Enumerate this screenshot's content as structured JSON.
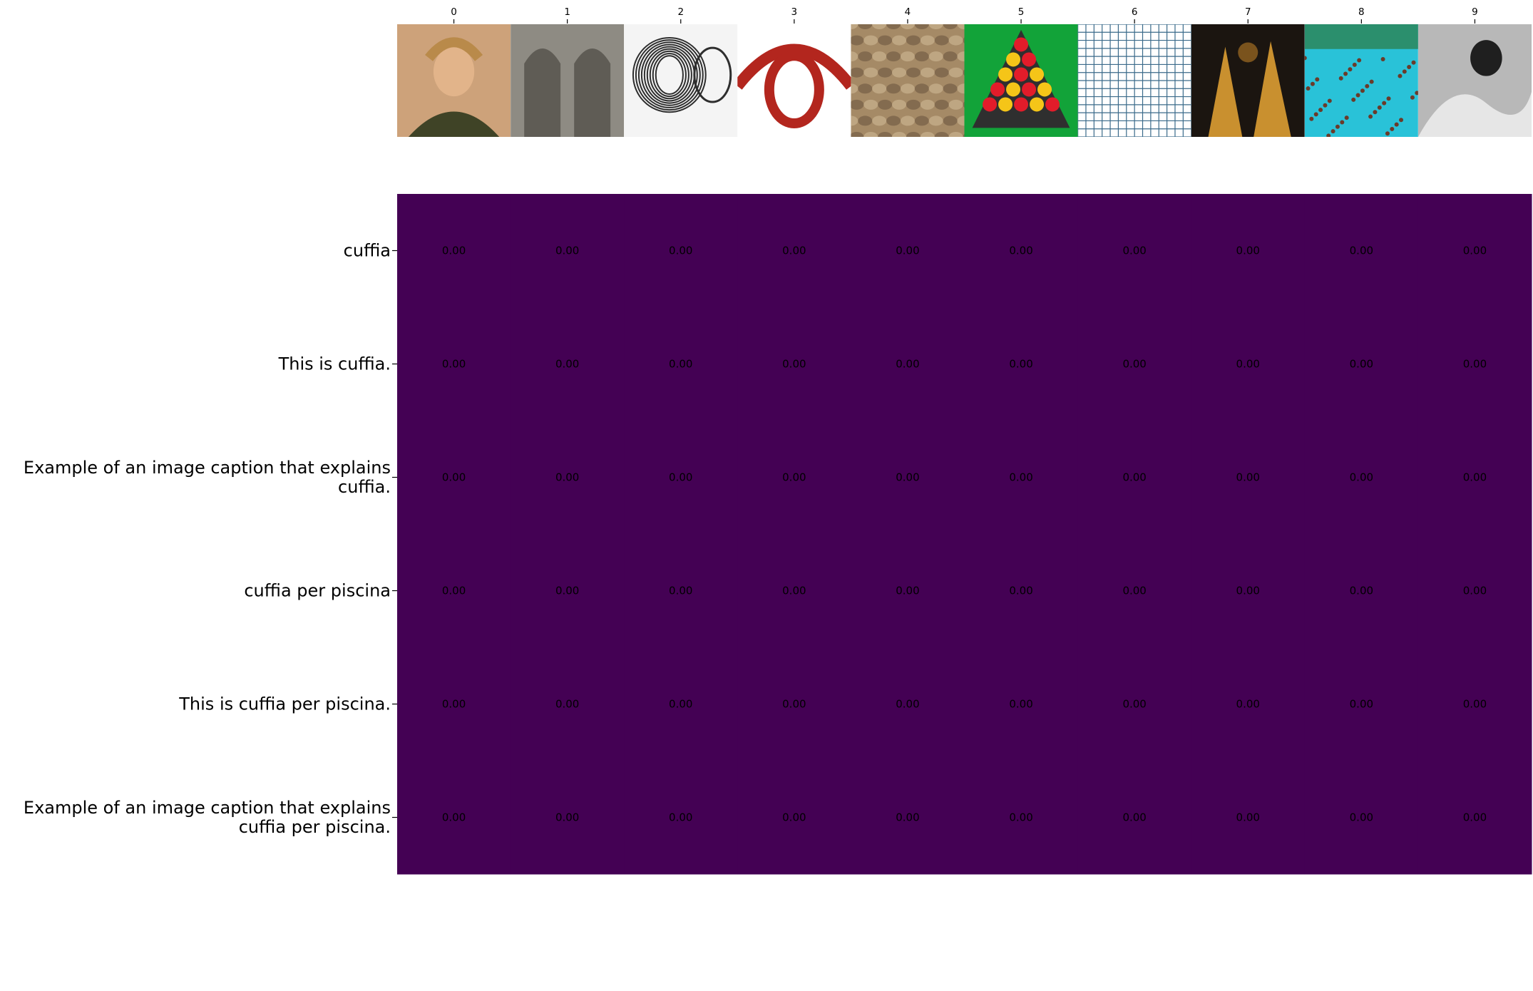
{
  "chart_data": {
    "type": "heatmap",
    "title": "",
    "xlabel": "",
    "ylabel": "",
    "x_ticks": [
      "0",
      "1",
      "2",
      "3",
      "4",
      "5",
      "6",
      "7",
      "8",
      "9"
    ],
    "x_tick_position": "top",
    "y_labels": [
      [
        "cuffia"
      ],
      [
        "This is cuffia."
      ],
      [
        "Example of an image caption that explains",
        "cuffia."
      ],
      [
        "cuffia per piscina"
      ],
      [
        "This is cuffia per piscina."
      ],
      [
        "Example of an image caption that explains",
        "cuffia per piscina."
      ]
    ],
    "values": [
      [
        0,
        0,
        0,
        0,
        0,
        0,
        0,
        0,
        0,
        0
      ],
      [
        0,
        0,
        0,
        0,
        0,
        0,
        0,
        0,
        0,
        0
      ],
      [
        0,
        0,
        0,
        0,
        0,
        0,
        0,
        0,
        0,
        0
      ],
      [
        0,
        0,
        0,
        0,
        0,
        0,
        0,
        0,
        0,
        0
      ],
      [
        0,
        0,
        0,
        0,
        0,
        0,
        0,
        0,
        0,
        0
      ],
      [
        0,
        0,
        0,
        0,
        0,
        0,
        0,
        0,
        0,
        0
      ]
    ],
    "value_format": "0.00",
    "colormap": "viridis",
    "cell_color": "#440154",
    "annotation_color": "#000000",
    "grid": false,
    "thumbnails": [
      {
        "index": 0,
        "subject": "woman with braided hair wearing a headset",
        "palette": [
          "#cda27a",
          "#3f4326",
          "#e2b48a"
        ]
      },
      {
        "index": 1,
        "subject": "stone arched window niches",
        "palette": [
          "#8e8b83",
          "#5f5c55",
          "#b4b1a8"
        ]
      },
      {
        "index": 2,
        "subject": "pen sketch of a ribbed bonnet",
        "palette": [
          "#f4f4f4",
          "#2e2e2e",
          "#9a9a9a"
        ]
      },
      {
        "index": 3,
        "subject": "red rope knot",
        "palette": [
          "#ffffff",
          "#b3261e",
          "#5a0f0b"
        ]
      },
      {
        "index": 4,
        "subject": "scaly textured surface",
        "palette": [
          "#a58a66",
          "#7b634a",
          "#c4ad8a"
        ]
      },
      {
        "index": 5,
        "subject": "snooker balls in a triangle rack",
        "palette": [
          "#12a339",
          "#e21c2a",
          "#f5c518"
        ]
      },
      {
        "index": 6,
        "subject": "blue square grid paper",
        "palette": [
          "#ffffff",
          "#3a6a8a",
          "#dfe8ee"
        ]
      },
      {
        "index": 7,
        "subject": "ancient greek painted pottery",
        "palette": [
          "#1b1510",
          "#c9902f",
          "#7a531d"
        ]
      },
      {
        "index": 8,
        "subject": "crowded swimming pool",
        "palette": [
          "#29c2d8",
          "#e9e3d3",
          "#2b8f6d"
        ]
      },
      {
        "index": 9,
        "subject": "swimmer wearing a swim cap",
        "palette": [
          "#b8b8b8",
          "#1f1f1f",
          "#e6e6e6"
        ]
      }
    ]
  }
}
